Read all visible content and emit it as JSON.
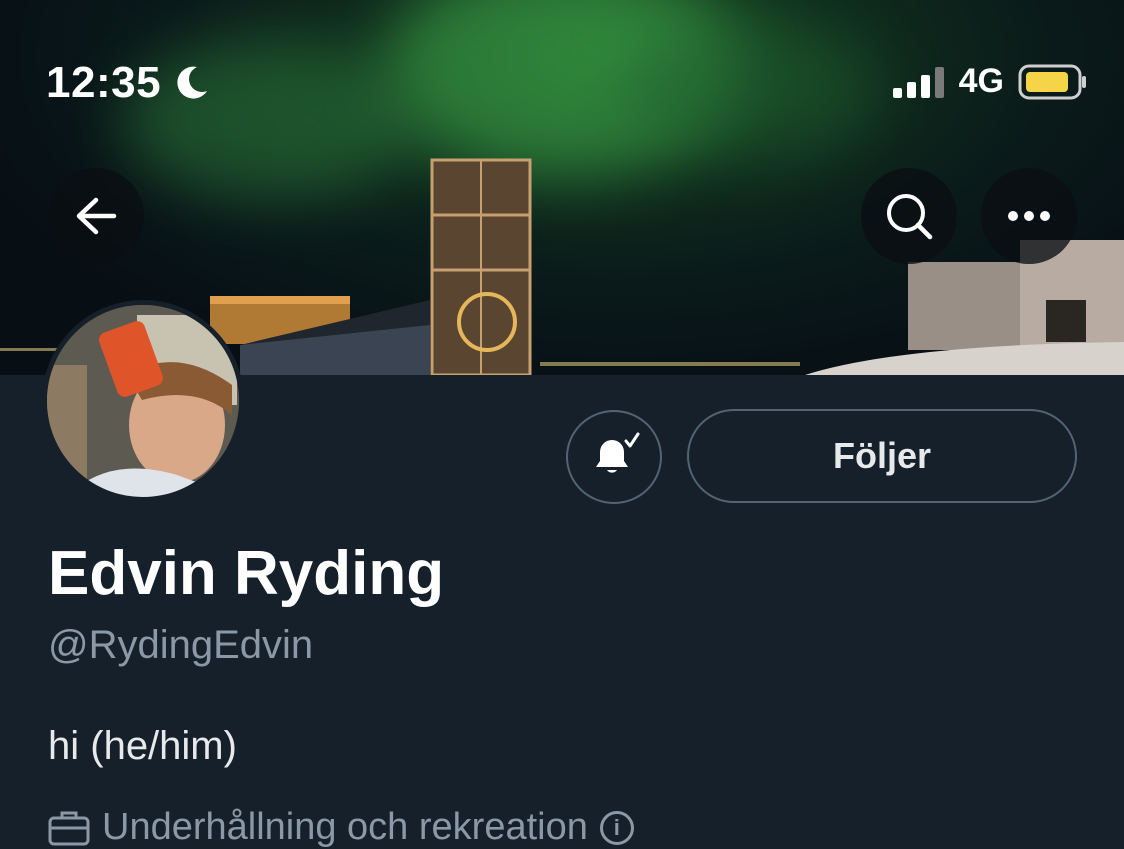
{
  "status_bar": {
    "time": "12:35",
    "network": "4G"
  },
  "profile": {
    "display_name": "Edvin Ryding",
    "handle": "@RydingEdvin",
    "bio": "hi (he/him)",
    "category": "Underhållning och rekreation",
    "follow_button_label": "Följer"
  },
  "icons": {
    "back": "arrow-left-icon",
    "search": "search-icon",
    "more": "more-horizontal-icon",
    "bell": "notification-bell-subscribed-icon",
    "category": "briefcase-icon",
    "info": "info-icon",
    "moon": "moon-icon",
    "signal": "signal-icon",
    "battery": "battery-icon"
  },
  "colors": {
    "background": "#15202b",
    "secondary_text": "#8b98a5",
    "button_border": "#536471",
    "battery": "#f5d547"
  }
}
